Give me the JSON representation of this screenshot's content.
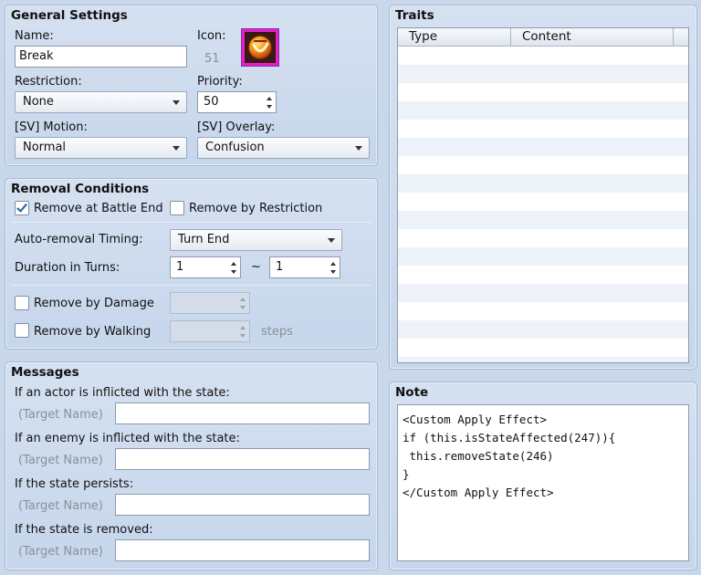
{
  "general": {
    "title": "General Settings",
    "name_label": "Name:",
    "name_value": "Break",
    "icon_label": "Icon:",
    "icon_index": "51",
    "restriction_label": "Restriction:",
    "restriction_value": "None",
    "priority_label": "Priority:",
    "priority_value": "50",
    "motion_label": "[SV] Motion:",
    "motion_value": "Normal",
    "overlay_label": "[SV] Overlay:",
    "overlay_value": "Confusion"
  },
  "removal": {
    "title": "Removal Conditions",
    "battle_end_label": "Remove at Battle End",
    "battle_end_checked": true,
    "restriction_label": "Remove by Restriction",
    "restriction_checked": false,
    "timing_label": "Auto-removal Timing:",
    "timing_value": "Turn End",
    "duration_label": "Duration in Turns:",
    "duration_min": "1",
    "tilde": "~",
    "duration_max": "1",
    "damage_label": "Remove by Damage",
    "damage_checked": false,
    "damage_value": "",
    "walking_label": "Remove by Walking",
    "walking_checked": false,
    "walking_value": "",
    "steps_label": "steps"
  },
  "messages": {
    "title": "Messages",
    "items": [
      {
        "label": "If an actor is inflicted with the state:",
        "prefix": "(Target Name)",
        "value": ""
      },
      {
        "label": "If an enemy is inflicted with the state:",
        "prefix": "(Target Name)",
        "value": ""
      },
      {
        "label": "If the state persists:",
        "prefix": "(Target Name)",
        "value": ""
      },
      {
        "label": "If the state is removed:",
        "prefix": "(Target Name)",
        "value": ""
      }
    ]
  },
  "traits": {
    "title": "Traits",
    "columns": [
      "Type",
      "Content"
    ]
  },
  "note": {
    "title": "Note",
    "text": "<Custom Apply Effect>\nif (this.isStateAffected(247)){\n this.removeState(246)\n}\n</Custom Apply Effect>"
  },
  "colors": {
    "panel_bg": "#d5e1f1",
    "icon_bg": "#e81ad5",
    "stripe": "#eef3fa"
  }
}
